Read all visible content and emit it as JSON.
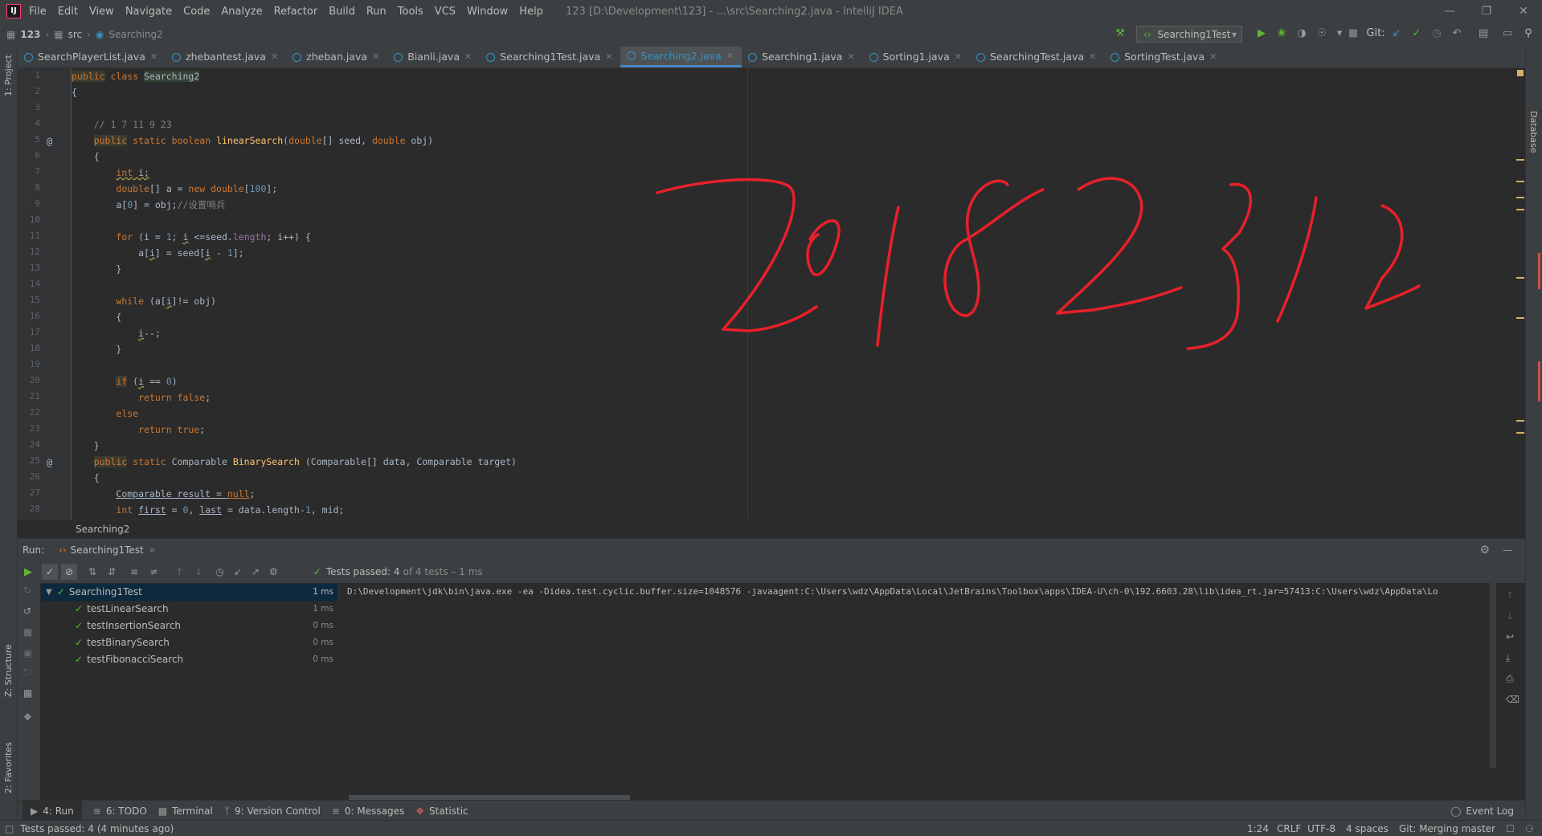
{
  "titlebar": {
    "menu": [
      "File",
      "Edit",
      "View",
      "Navigate",
      "Code",
      "Analyze",
      "Refactor",
      "Build",
      "Run",
      "Tools",
      "VCS",
      "Window",
      "Help"
    ],
    "window_title": "123 [D:\\Development\\123] - ...\\src\\Searching2.java - IntelliJ IDEA"
  },
  "navbar": {
    "crumbs": [
      "123",
      "src",
      "Searching2"
    ],
    "run_config": "Searching1Test",
    "git_label": "Git:"
  },
  "tabs": [
    {
      "label": "SearchPlayerList.java"
    },
    {
      "label": "zhebantest.java"
    },
    {
      "label": "zheban.java"
    },
    {
      "label": "Bianli.java"
    },
    {
      "label": "Searching1Test.java"
    },
    {
      "label": "Searching2.java"
    },
    {
      "label": "Searching1.java"
    },
    {
      "label": "Sorting1.java"
    },
    {
      "label": "SearchingTest.java"
    },
    {
      "label": "SortingTest.java"
    }
  ],
  "side_panels": {
    "project": "1: Project",
    "structure": "Z: Structure",
    "favorites": "2: Favorites",
    "database": "Database"
  },
  "editor": {
    "line_numbers": [
      "1",
      "2",
      "3",
      "4",
      "5",
      "6",
      "7",
      "8",
      "9",
      "10",
      "11",
      "12",
      "13",
      "14",
      "15",
      "16",
      "17",
      "18",
      "19",
      "20",
      "21",
      "22",
      "23",
      "24",
      "25",
      "26",
      "27",
      "28"
    ],
    "breadcrumb": "Searching2",
    "handwriting": "20182312"
  },
  "run_panel": {
    "label": "Run:",
    "tab": "Searching1Test",
    "status_text": "Tests passed: 4",
    "status_suffix": "of 4 tests – 1 ms",
    "tree": [
      {
        "name": "Searching1Test",
        "time": "1 ms"
      },
      {
        "name": "testLinearSearch",
        "time": "1 ms"
      },
      {
        "name": "testInsertionSearch",
        "time": "0 ms"
      },
      {
        "name": "testBinarySearch",
        "time": "0 ms"
      },
      {
        "name": "testFibonacciSearch",
        "time": "0 ms"
      }
    ],
    "console_line": "D:\\Development\\jdk\\bin\\java.exe -ea -Didea.test.cyclic.buffer.size=1048576 -javaagent:C:\\Users\\wdz\\AppData\\Local\\JetBrains\\Toolbox\\apps\\IDEA-U\\ch-0\\192.6603.28\\lib\\idea_rt.jar=57413:C:\\Users\\wdz\\AppData\\Lo"
  },
  "bottom_tools": [
    "4: Run",
    "6: TODO",
    "Terminal",
    "9: Version Control",
    "0: Messages",
    "Statistic"
  ],
  "event_log": "Event Log",
  "statusbar": {
    "message": "Tests passed: 4 (4 minutes ago)",
    "position": "1:24",
    "line_sep": "CRLF",
    "encoding": "UTF-8",
    "indent": "4 spaces",
    "git": "Git: Merging master"
  },
  "colors": {
    "accent": "#4a88c7",
    "pass": "#5fb832",
    "keyword": "#cc7832",
    "handwriting": "#e8202a"
  }
}
